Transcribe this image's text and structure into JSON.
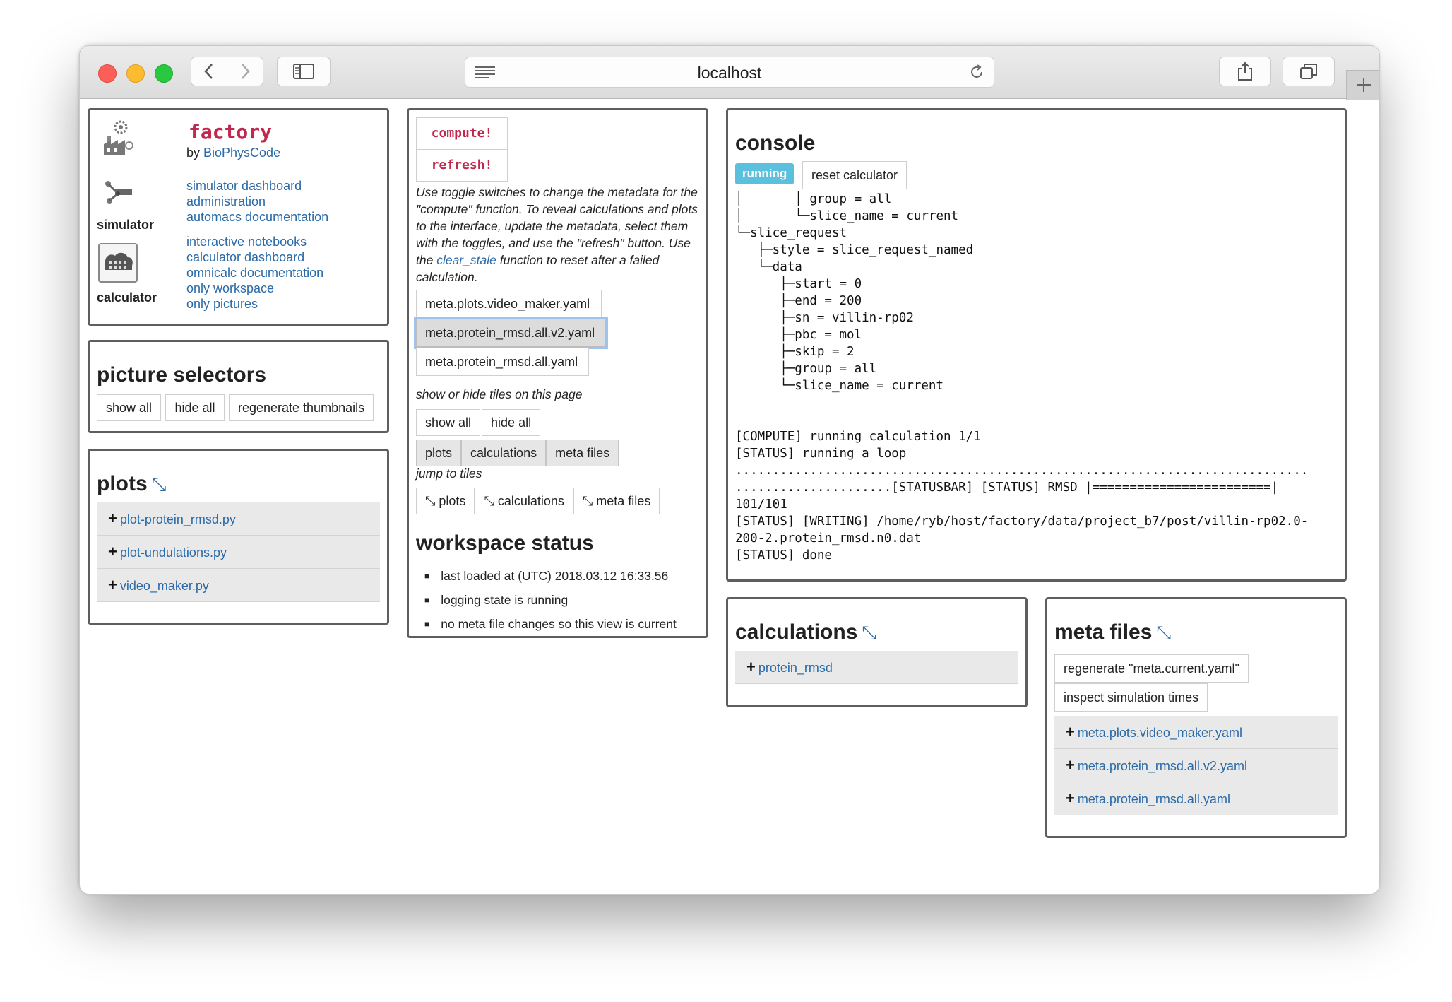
{
  "browser": {
    "url": "localhost"
  },
  "factory": {
    "title": "factory",
    "by_prefix": "by ",
    "by_link": "BioPhysCode",
    "simulator_label": "simulator",
    "calculator_label": "calculator",
    "links_simulator": [
      "simulator dashboard",
      "administration",
      "automacs documentation"
    ],
    "links_calculator": [
      "interactive notebooks",
      "calculator dashboard",
      "omnicalc documentation",
      "only workspace",
      "only pictures"
    ]
  },
  "picture_selectors": {
    "title": "picture selectors",
    "buttons": [
      "show all",
      "hide all",
      "regenerate thumbnails"
    ]
  },
  "plots": {
    "title": "plots",
    "arrow": "⤡",
    "items": [
      "plot-protein_rmsd.py",
      "plot-undulations.py",
      "video_maker.py"
    ]
  },
  "compute": {
    "compute_label": "compute!",
    "refresh_label": "refresh!",
    "instructions_1": "Use toggle switches to change the metadata for the \"compute\" function. To reveal calculations and plots to the interface, update the metadata, select them with the toggles, and use the \"refresh\" button. Use the ",
    "instructions_link": "clear_stale",
    "instructions_2": " function to reset after a failed calculation.",
    "meta_toggles": [
      "meta.plots.video_maker.yaml",
      "meta.protein_rmsd.all.v2.yaml",
      "meta.protein_rmsd.all.yaml"
    ],
    "show_hide_label": "show or hide tiles on this page",
    "show_all": "show all",
    "hide_all": "hide all",
    "tile_toggles": [
      "plots",
      "calculations",
      "meta files"
    ],
    "jump_label": "jump to tiles",
    "jump_links": [
      "⤡ plots",
      "⤡ calculations",
      "⤡ meta files"
    ]
  },
  "workspace": {
    "title": "workspace status",
    "items": [
      "last loaded at (UTC) 2018.03.12 16:33.56",
      "logging state is running",
      "no meta file changes so this view is current"
    ]
  },
  "console": {
    "title": "console",
    "status_badge": "running",
    "reset_label": "reset calculator",
    "log": "│       │ group = all\n│       └─slice_name = current\n└─slice_request\n   ├─style = slice_request_named\n   └─data\n      ├─start = 0\n      ├─end = 200\n      ├─sn = villin-rp02\n      ├─pbc = mol\n      ├─skip = 2\n      ├─group = all\n      └─slice_name = current\n\n\n[COMPUTE] running calculation 1/1\n[STATUS] running a loop\n.............................................................................\n.....................[STATUSBAR] [STATUS] RMSD |========================|\n101/101\n[STATUS] [WRITING] /home/ryb/host/factory/data/project_b7/post/villin-rp02.0-\n200-2.protein_rmsd.n0.dat\n[STATUS] done"
  },
  "calculations": {
    "title": "calculations",
    "arrow": "⤡",
    "items": [
      "protein_rmsd"
    ]
  },
  "meta_files": {
    "title": "meta files",
    "arrow": "⤡",
    "regenerate_label": "regenerate \"meta.current.yaml\"",
    "inspect_label": "inspect simulation times",
    "items": [
      "meta.plots.video_maker.yaml",
      "meta.protein_rmsd.all.v2.yaml",
      "meta.protein_rmsd.all.yaml"
    ]
  },
  "colors": {
    "accent_link": "#2a6aa8",
    "badge": "#5bc0de",
    "code_red": "#c0284d",
    "panel_border": "#5e5e5e"
  }
}
